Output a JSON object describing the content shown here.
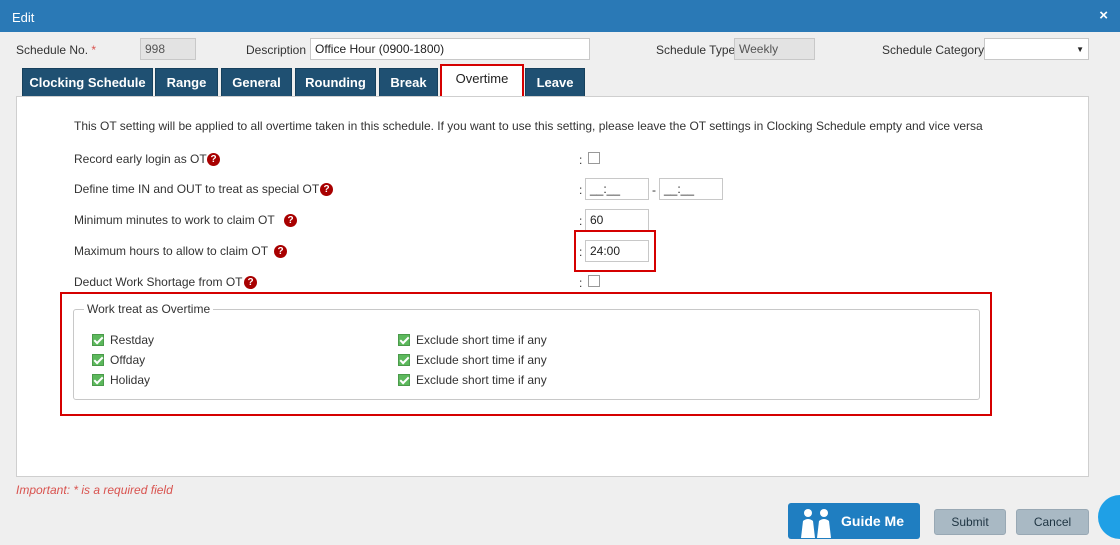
{
  "window": {
    "title": "Edit",
    "close": "×"
  },
  "header": {
    "schedule_no_label": "Schedule No.",
    "required_mark": "*",
    "schedule_no_value": "998",
    "description_label": "Description",
    "description_value": "Office Hour (0900-1800)",
    "schedule_type_label": "Schedule Type",
    "schedule_type_value": "Weekly",
    "schedule_category_label": "Schedule Category",
    "schedule_category_value": ""
  },
  "tabs": [
    "Clocking Schedule",
    "Range",
    "General",
    "Rounding",
    "Break",
    "Overtime",
    "Leave"
  ],
  "active_tab": "Overtime",
  "overtime": {
    "note": "This OT setting will be applied to all overtime taken in this schedule. If you want to use this setting, please leave the OT settings in Clocking Schedule empty and vice versa",
    "record_early_login_label": "Record early login as OT",
    "record_early_login_checked": false,
    "special_time_label": "Define time IN and OUT to treat as special OT",
    "special_time_in": "__:__",
    "special_time_out": "__:__",
    "dash": "-",
    "min_minutes_label": "Minimum minutes to work to claim OT",
    "min_minutes_value": "60",
    "max_hours_label": "Maximum hours to allow to claim OT",
    "max_hours_value": "24:00",
    "deduct_shortage_label": "Deduct Work Shortage from OT",
    "deduct_shortage_checked": false,
    "colon": ":",
    "help_glyph": "?"
  },
  "work_treat": {
    "legend": "Work treat as Overtime",
    "rows": [
      {
        "label": "Restday",
        "checked": true,
        "exclude_label": "Exclude short time if any",
        "exclude_checked": true
      },
      {
        "label": "Offday",
        "checked": true,
        "exclude_label": "Exclude short time if any",
        "exclude_checked": true
      },
      {
        "label": "Holiday",
        "checked": true,
        "exclude_label": "Exclude short time if any",
        "exclude_checked": true
      }
    ]
  },
  "footer": {
    "important_note": "Important: * is a required field",
    "guide_me": "Guide Me",
    "submit": "Submit",
    "cancel": "Cancel"
  },
  "colors": {
    "titlebar": "#2a79b6",
    "tab": "#1f5072",
    "highlight": "#d50000",
    "help": "#a80000",
    "check": "#5cb85c"
  }
}
